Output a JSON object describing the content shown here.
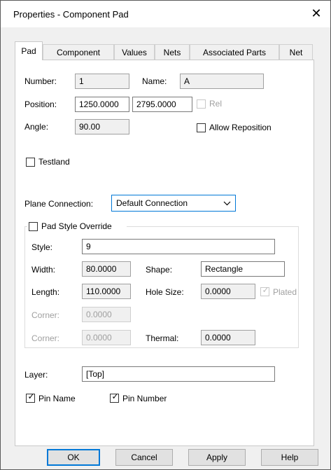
{
  "window": {
    "title": "Properties - Component Pad",
    "close_glyph": "✕"
  },
  "tabs": [
    {
      "label": "Pad"
    },
    {
      "label": "Component"
    },
    {
      "label": "Values"
    },
    {
      "label": "Nets"
    },
    {
      "label": "Associated Parts"
    },
    {
      "label": "Net"
    }
  ],
  "pad": {
    "number_label": "Number:",
    "number_value": "1",
    "name_label": "Name:",
    "name_value": "A",
    "position_label": "Position:",
    "position_x": "1250.0000",
    "position_y": "2795.0000",
    "rel_label": "Rel",
    "rel_checked": false,
    "angle_label": "Angle:",
    "angle_value": "90.00",
    "allow_reposition_label": "Allow Reposition",
    "allow_reposition_checked": false,
    "testland_label": "Testland",
    "testland_checked": false,
    "plane_connection_label": "Plane Connection:",
    "plane_connection_value": "Default Connection",
    "pad_style_override_label": "Pad Style Override",
    "pad_style_override_checked": false,
    "style_label": "Style:",
    "style_value": "9",
    "width_label": "Width:",
    "width_value": "80.0000",
    "shape_label": "Shape:",
    "shape_value": "Rectangle",
    "length_label": "Length:",
    "length_value": "110.0000",
    "hole_size_label": "Hole Size:",
    "hole_size_value": "0.0000",
    "plated_label": "Plated",
    "plated_checked": true,
    "corner1_label": "Corner:",
    "corner1_value": "0.0000",
    "corner2_label": "Corner:",
    "corner2_value": "0.0000",
    "thermal_label": "Thermal:",
    "thermal_value": "0.0000",
    "layer_label": "Layer:",
    "layer_value": "[Top]",
    "pin_name_label": "Pin Name",
    "pin_name_checked": true,
    "pin_number_label": "Pin Number",
    "pin_number_checked": true
  },
  "buttons": {
    "ok": "OK",
    "cancel": "Cancel",
    "apply": "Apply",
    "help": "Help"
  },
  "icons": {
    "checkmark": "✓",
    "chevron": "⌵"
  },
  "colors": {
    "focus_accent": "#0078d7",
    "disabled_text": "#a0a0a0"
  }
}
